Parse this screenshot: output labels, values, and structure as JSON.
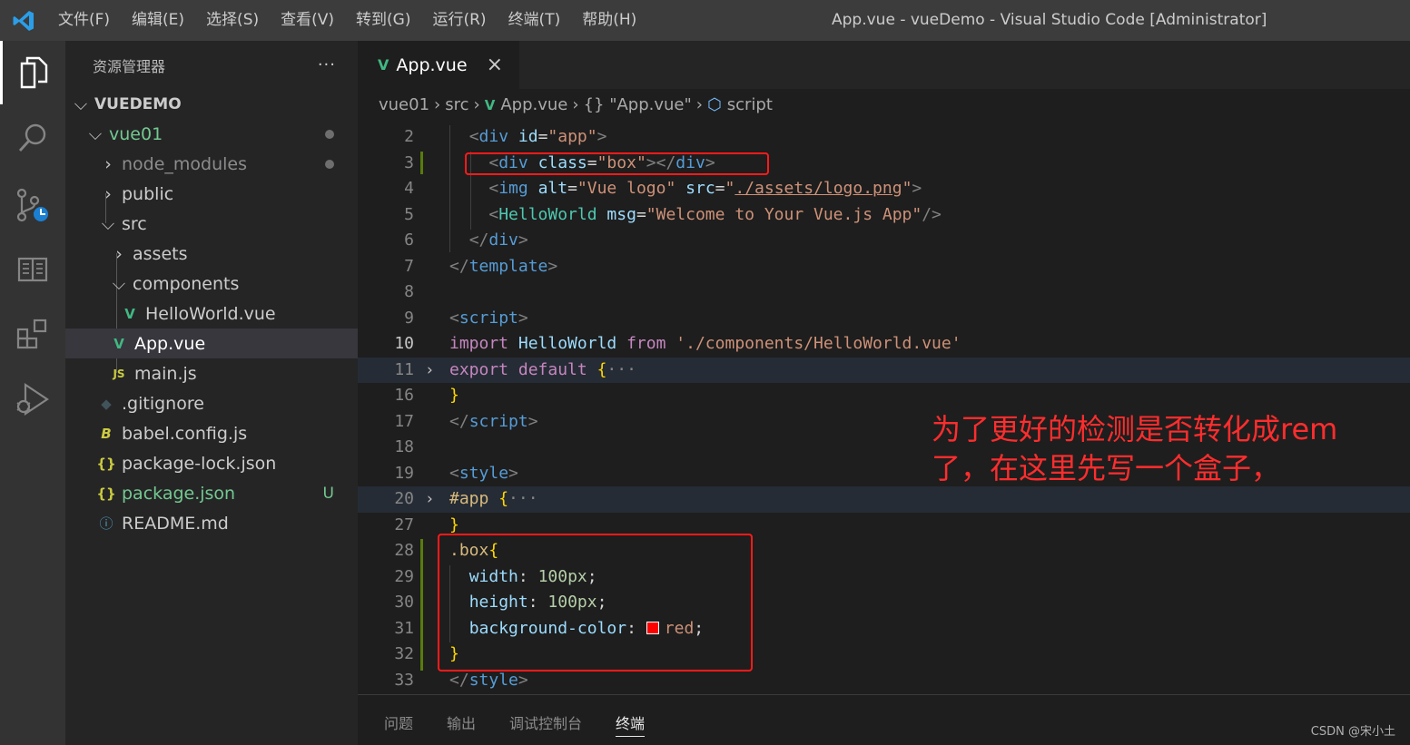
{
  "window": {
    "title": "App.vue - vueDemo - Visual Studio Code [Administrator]",
    "menu": [
      "文件(F)",
      "编辑(E)",
      "选择(S)",
      "查看(V)",
      "转到(G)",
      "运行(R)",
      "终端(T)",
      "帮助(H)"
    ]
  },
  "activity": [
    "explorer-icon",
    "search-icon",
    "source-control-icon",
    "book-icon",
    "extensions-icon",
    "run-debug-icon"
  ],
  "sidebar": {
    "title": "资源管理器",
    "more": "···",
    "root": "VUEDEMO",
    "items": [
      {
        "label": "vue01",
        "icon": "",
        "chevron": "down"
      },
      {
        "label": "node_modules",
        "icon": "",
        "chevron": "right"
      },
      {
        "label": "public",
        "icon": "",
        "chevron": "right"
      },
      {
        "label": "src",
        "icon": "",
        "chevron": "down"
      },
      {
        "label": "assets",
        "icon": "",
        "chevron": "right"
      },
      {
        "label": "components",
        "icon": "",
        "chevron": "down"
      },
      {
        "label": "HelloWorld.vue",
        "icon": "V",
        "chevron": ""
      },
      {
        "label": "App.vue",
        "icon": "V",
        "chevron": ""
      },
      {
        "label": "main.js",
        "icon": "JS",
        "chevron": ""
      },
      {
        "label": ".gitignore",
        "icon": "◆",
        "chevron": ""
      },
      {
        "label": "babel.config.js",
        "icon": "B",
        "chevron": ""
      },
      {
        "label": "package-lock.json",
        "icon": "{}",
        "chevron": ""
      },
      {
        "label": "package.json",
        "icon": "{}",
        "chevron": "",
        "badge": "U"
      },
      {
        "label": "README.md",
        "icon": "ⓘ",
        "chevron": ""
      }
    ]
  },
  "editor": {
    "tab": "App.vue",
    "close": "×",
    "breadcrumb": [
      "vue01",
      "src",
      "App.vue",
      "{} \"App.vue\"",
      "script"
    ],
    "line_numbers": [
      "2",
      "3",
      "4",
      "5",
      "6",
      "7",
      "8",
      "9",
      "10",
      "11",
      "16",
      "17",
      "18",
      "19",
      "20",
      "27",
      "28",
      "29",
      "30",
      "31",
      "32",
      "33"
    ]
  },
  "annotation": {
    "line1": "为了更好的检测是否转化成rem",
    "line2": "了，在这里先写一个盒子，"
  },
  "panel": {
    "tabs": [
      "问题",
      "输出",
      "调试控制台",
      "终端"
    ],
    "active": "终端"
  },
  "watermark": "CSDN @宋小土",
  "colors": {
    "accent_red": "#ff1a1a",
    "vue_green": "#41b883"
  }
}
